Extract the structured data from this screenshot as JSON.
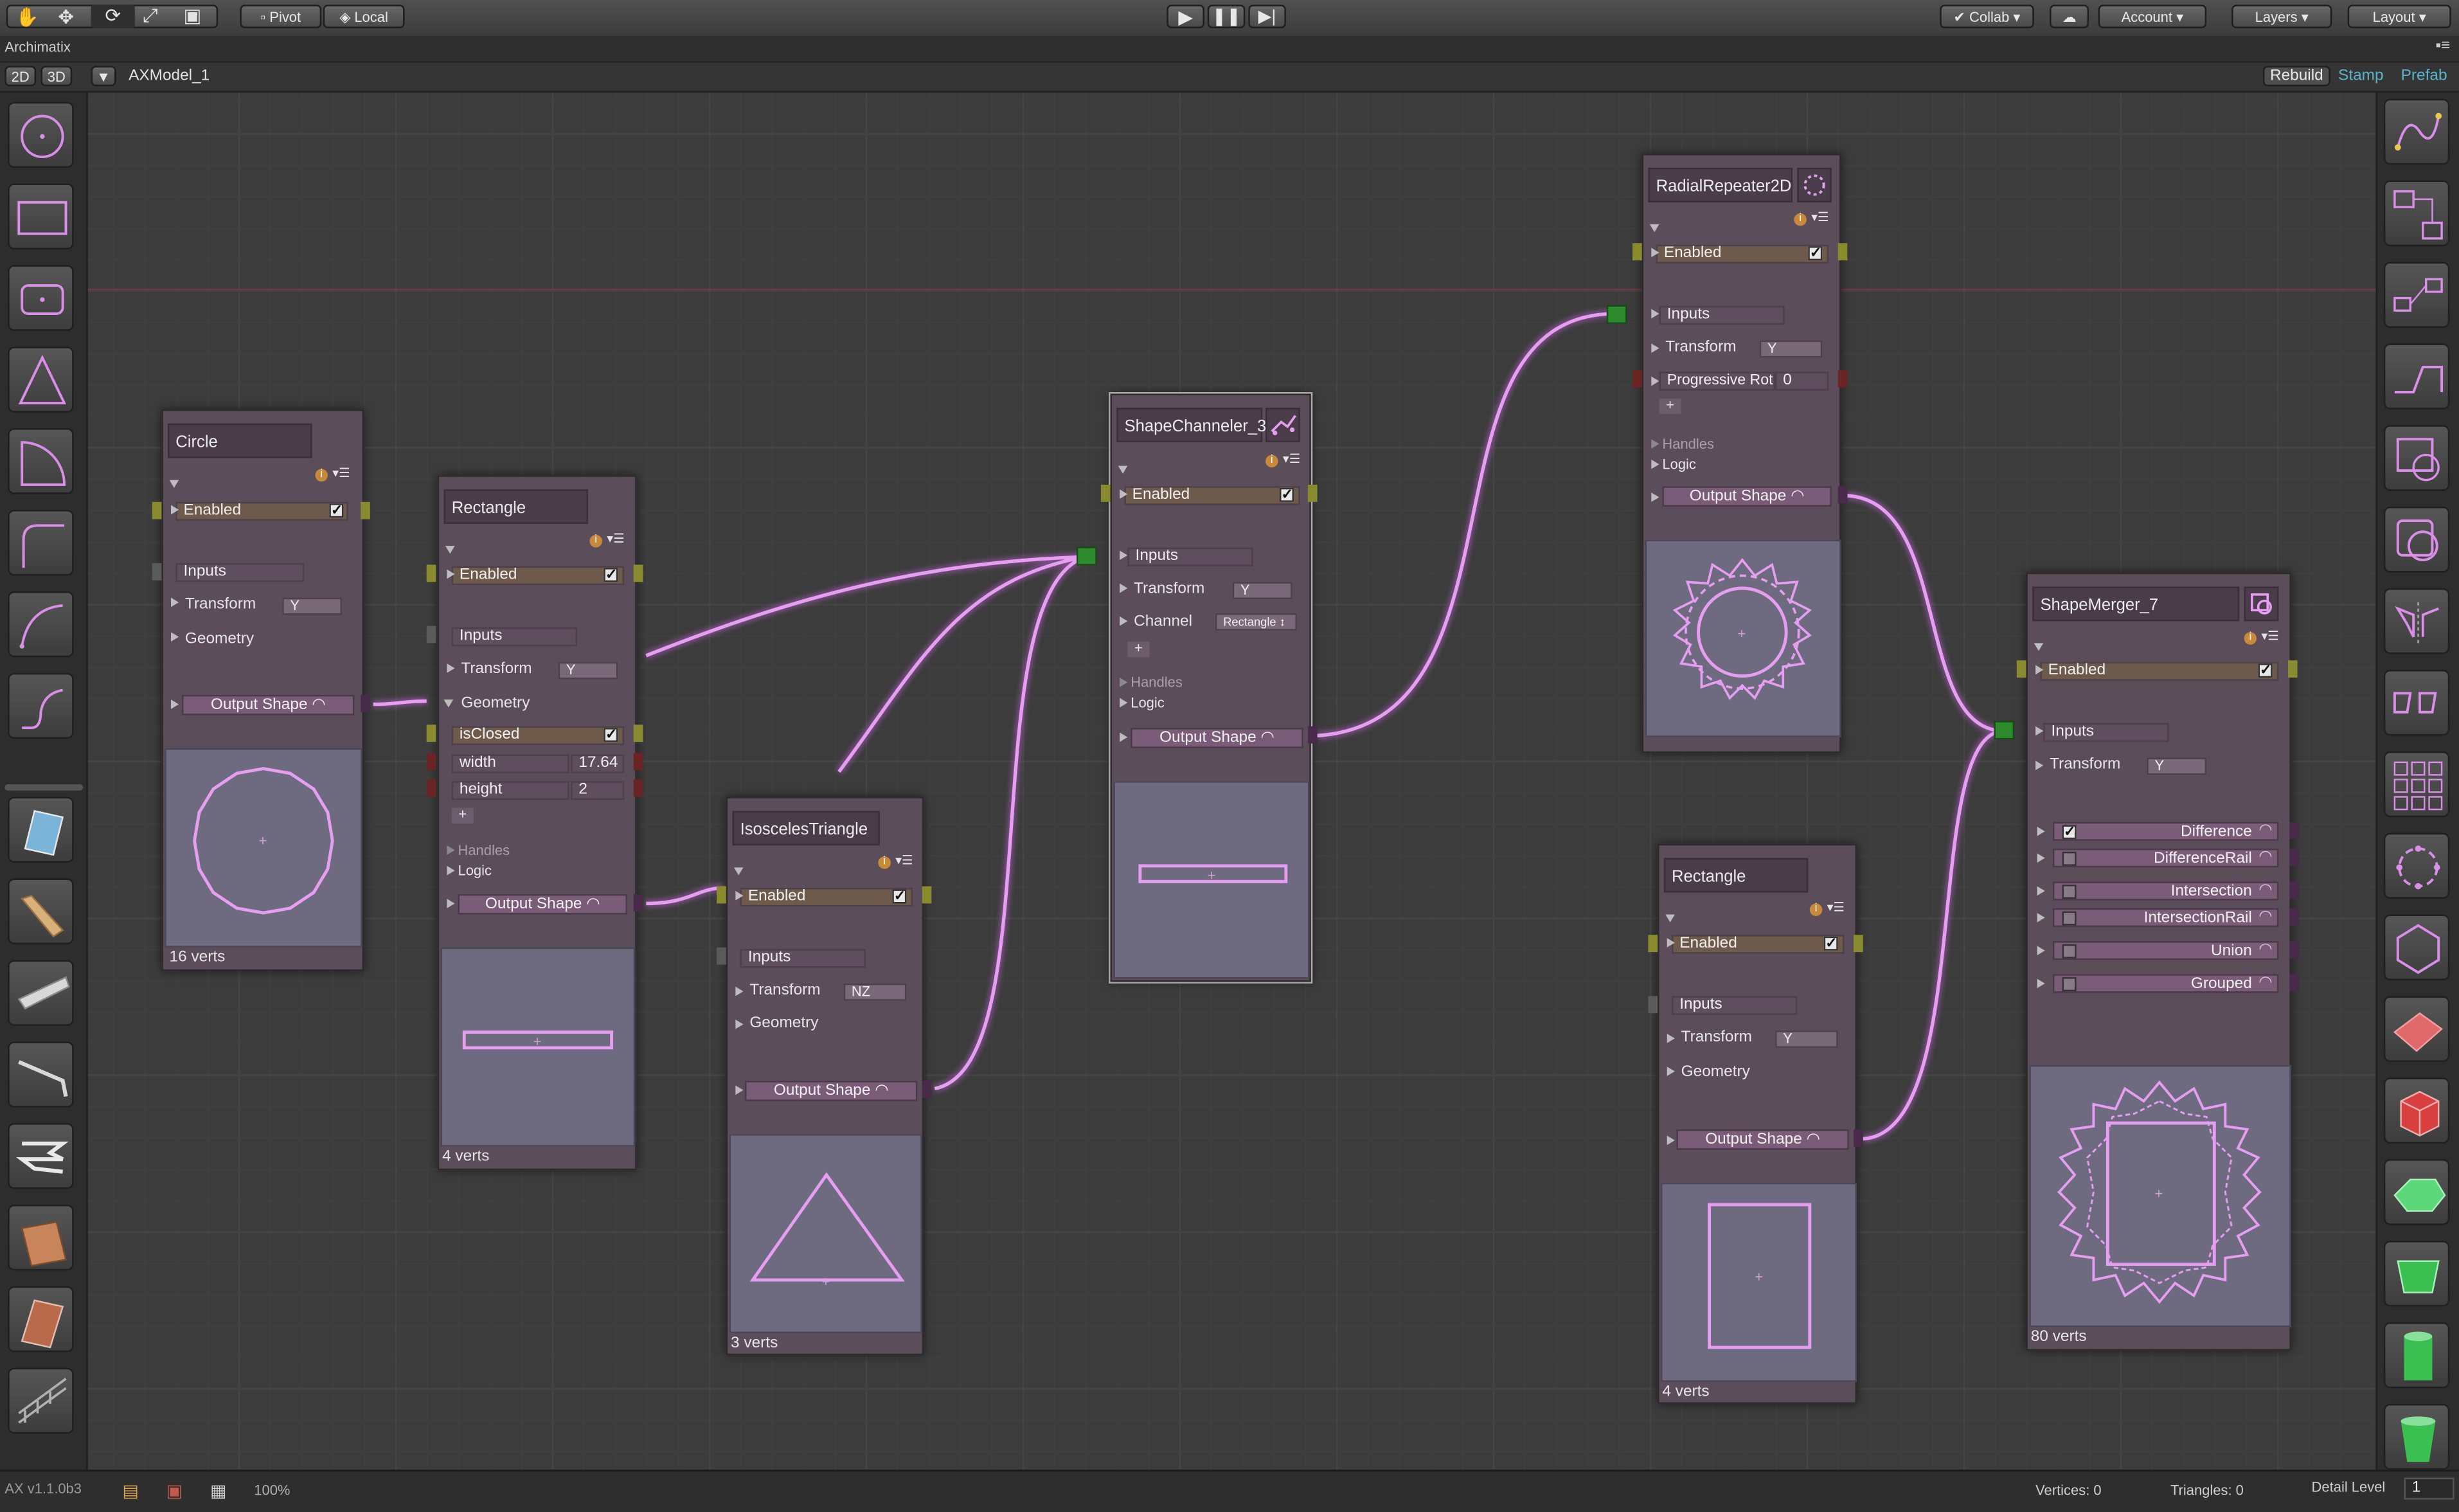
{
  "toolbar": {
    "pivot_label": "Pivot",
    "local_label": "Local",
    "collab_label": "Collab",
    "account_label": "Account",
    "layers_label": "Layers",
    "layout_label": "Layout"
  },
  "window": {
    "title": "Archimatix"
  },
  "editor": {
    "view_2d": "2D",
    "view_3d": "3D",
    "model_name": "AXModel_1",
    "rebuild_label": "Rebuild",
    "stamp_label": "Stamp",
    "prefab_label": "Prefab"
  },
  "nodes": {
    "circle": {
      "title": "Circle",
      "enabled": "Enabled",
      "inputs": "Inputs",
      "transform": "Transform",
      "transform_axis": "Y",
      "geometry": "Geometry",
      "output": "Output Shape",
      "verts": "16 verts"
    },
    "rect1": {
      "title": "Rectangle",
      "enabled": "Enabled",
      "inputs": "Inputs",
      "transform": "Transform",
      "transform_axis": "Y",
      "geometry": "Geometry",
      "isclosed": "isClosed",
      "width_label": "width",
      "width_value": "17.64",
      "height_label": "height",
      "height_value": "2",
      "plus": "+",
      "handles": "Handles",
      "logic": "Logic",
      "output": "Output Shape",
      "verts": "4 verts"
    },
    "tri": {
      "title": "IsoscelesTriangle",
      "enabled": "Enabled",
      "inputs": "Inputs",
      "transform": "Transform",
      "transform_axis": "NZ",
      "geometry": "Geometry",
      "output": "Output Shape",
      "verts": "3 verts"
    },
    "channeler": {
      "title": "ShapeChanneler_3",
      "enabled": "Enabled",
      "inputs": "Inputs",
      "transform": "Transform",
      "transform_axis": "Y",
      "channel": "Channel",
      "channel_value": "Rectangle ↕",
      "plus": "+",
      "handles": "Handles",
      "logic": "Logic",
      "output": "Output Shape"
    },
    "radial": {
      "title": "RadialRepeater2D",
      "enabled": "Enabled",
      "inputs": "Inputs",
      "transform": "Transform",
      "transform_axis": "Y",
      "prog_rot": "Progressive Rot",
      "prog_rot_value": "0",
      "plus": "+",
      "handles": "Handles",
      "logic": "Logic",
      "output": "Output Shape"
    },
    "rect2": {
      "title": "Rectangle",
      "enabled": "Enabled",
      "inputs": "Inputs",
      "transform": "Transform",
      "transform_axis": "Y",
      "geometry": "Geometry",
      "output": "Output Shape",
      "verts": "4 verts"
    },
    "merger": {
      "title": "ShapeMerger_7",
      "enabled": "Enabled",
      "inputs": "Inputs",
      "transform": "Transform",
      "transform_axis": "Y",
      "outputs": [
        {
          "label": "Difference",
          "checked": true
        },
        {
          "label": "DifferenceRail",
          "checked": false
        },
        {
          "label": "Intersection",
          "checked": false
        },
        {
          "label": "IntersectionRail",
          "checked": false
        },
        {
          "label": "Union",
          "checked": false
        },
        {
          "label": "Grouped",
          "checked": false
        }
      ],
      "verts": "80 verts"
    }
  },
  "status": {
    "version": "AX v1.1.0b3",
    "zoom": "100%",
    "vertices": "Vertices: 0",
    "triangles": "Triangles: 0",
    "detail_label": "Detail Level",
    "detail_value": "1"
  },
  "colors": {
    "wire": "#e59ef0",
    "node_bg": "#5c4d5b",
    "preview_bg": "#6e6a80",
    "port_olive": "#8a8a2f",
    "port_maroon": "#6b2424"
  },
  "icons": {
    "left_tools": [
      "circle-shape-icon",
      "rectangle-shape-icon",
      "rounded-rectangle-icon",
      "triangle-shape-icon",
      "arc-shape-icon",
      "corner-shape-icon",
      "curve-shape-icon",
      "step-shape-icon",
      "stairs-icon",
      "ladder-icon",
      "roof-icon",
      "canopy-icon",
      "stacked-layers-icon",
      "spiral-stair-icon",
      "rail-stair-icon",
      "truss-icon"
    ],
    "right_tools": [
      "spline-icon",
      "shape-distributor-icon",
      "grid-repeater-icon",
      "path-shape-icon",
      "shape-offsetter-icon",
      "radial-repeater-icon",
      "mirror-icon",
      "linear-repeater-icon",
      "grid-repeater-2d-icon",
      "radial-repeater-2d-icon",
      "rotate-repeater-icon",
      "plane-icon",
      "box-icon",
      "polygon-icon",
      "extrude-icon",
      "cylinder-icon",
      "lathe-icon"
    ]
  }
}
